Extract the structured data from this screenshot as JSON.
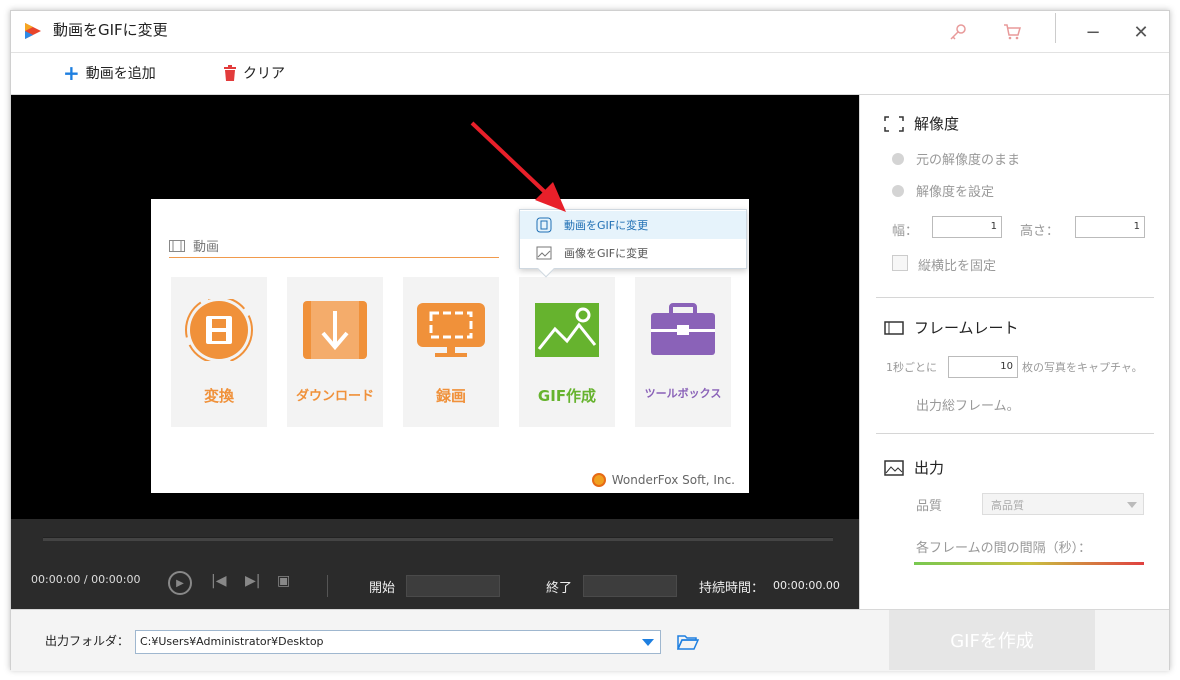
{
  "window": {
    "title": "動画をGIFに変更"
  },
  "titlebar": {
    "key_icon": "key-icon",
    "cart_icon": "cart-icon",
    "minimize_glyph": "−",
    "close_glyph": "✕"
  },
  "toolbar": {
    "add_video_label": "動画を追加",
    "clear_label": "クリア"
  },
  "preview": {
    "category_label": "動画",
    "tiles": [
      {
        "label": "変換",
        "color": "#f0913a"
      },
      {
        "label": "ダウンロード",
        "color": "#f0913a"
      },
      {
        "label": "録画",
        "color": "#f0913a"
      },
      {
        "label": "GIF作成",
        "color": "#66b32e"
      },
      {
        "label": "ツールボックス",
        "color": "#8a62b8"
      }
    ],
    "popup_items": [
      "動画をGIFに変更",
      "画像をGIFに変更"
    ],
    "credit": "WonderFox Soft, Inc."
  },
  "controls": {
    "time_readout": "00:00:00 / 00:00:00",
    "start_label": "開始",
    "end_label": "終了",
    "duration_label": "持続時間：",
    "duration_value": "00:00:00.00"
  },
  "settings": {
    "resolution": {
      "title": "解像度",
      "keep_original": "元の解像度のまま",
      "set_resolution": "解像度を設定",
      "width_label": "幅：",
      "width_value": "1",
      "height_label": "高さ：",
      "height_value": "1",
      "lock_ratio": "縦横比を固定"
    },
    "framerate": {
      "title": "フレームレート",
      "per_second_prefix": "1秒ごとに",
      "per_second_value": "10",
      "per_second_suffix": "枚の写真をキャプチャ。",
      "total_frames": "出力総フレーム。"
    },
    "output": {
      "title": "出力",
      "quality_label": "品質",
      "quality_value": "高品質",
      "interval_label": "各フレームの間の間隔（秒）："
    }
  },
  "bottom": {
    "output_folder_label": "出力フォルダ：",
    "output_path": "C:¥Users¥Administrator¥Desktop",
    "make_gif_label": "GIFを作成"
  },
  "colors": {
    "accent_blue": "#1e7fe0",
    "arrow_red": "#e8202a"
  }
}
